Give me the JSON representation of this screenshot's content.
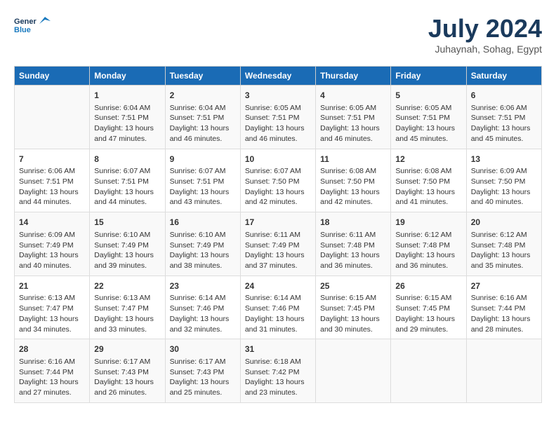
{
  "header": {
    "logo_line1": "General",
    "logo_line2": "Blue",
    "title": "July 2024",
    "subtitle": "Juhaynah, Sohag, Egypt"
  },
  "days_of_week": [
    "Sunday",
    "Monday",
    "Tuesday",
    "Wednesday",
    "Thursday",
    "Friday",
    "Saturday"
  ],
  "weeks": [
    [
      {
        "day": "",
        "content": ""
      },
      {
        "day": "1",
        "content": "Sunrise: 6:04 AM\nSunset: 7:51 PM\nDaylight: 13 hours\nand 47 minutes."
      },
      {
        "day": "2",
        "content": "Sunrise: 6:04 AM\nSunset: 7:51 PM\nDaylight: 13 hours\nand 46 minutes."
      },
      {
        "day": "3",
        "content": "Sunrise: 6:05 AM\nSunset: 7:51 PM\nDaylight: 13 hours\nand 46 minutes."
      },
      {
        "day": "4",
        "content": "Sunrise: 6:05 AM\nSunset: 7:51 PM\nDaylight: 13 hours\nand 46 minutes."
      },
      {
        "day": "5",
        "content": "Sunrise: 6:05 AM\nSunset: 7:51 PM\nDaylight: 13 hours\nand 45 minutes."
      },
      {
        "day": "6",
        "content": "Sunrise: 6:06 AM\nSunset: 7:51 PM\nDaylight: 13 hours\nand 45 minutes."
      }
    ],
    [
      {
        "day": "7",
        "content": "Sunrise: 6:06 AM\nSunset: 7:51 PM\nDaylight: 13 hours\nand 44 minutes."
      },
      {
        "day": "8",
        "content": "Sunrise: 6:07 AM\nSunset: 7:51 PM\nDaylight: 13 hours\nand 44 minutes."
      },
      {
        "day": "9",
        "content": "Sunrise: 6:07 AM\nSunset: 7:51 PM\nDaylight: 13 hours\nand 43 minutes."
      },
      {
        "day": "10",
        "content": "Sunrise: 6:07 AM\nSunset: 7:50 PM\nDaylight: 13 hours\nand 42 minutes."
      },
      {
        "day": "11",
        "content": "Sunrise: 6:08 AM\nSunset: 7:50 PM\nDaylight: 13 hours\nand 42 minutes."
      },
      {
        "day": "12",
        "content": "Sunrise: 6:08 AM\nSunset: 7:50 PM\nDaylight: 13 hours\nand 41 minutes."
      },
      {
        "day": "13",
        "content": "Sunrise: 6:09 AM\nSunset: 7:50 PM\nDaylight: 13 hours\nand 40 minutes."
      }
    ],
    [
      {
        "day": "14",
        "content": "Sunrise: 6:09 AM\nSunset: 7:49 PM\nDaylight: 13 hours\nand 40 minutes."
      },
      {
        "day": "15",
        "content": "Sunrise: 6:10 AM\nSunset: 7:49 PM\nDaylight: 13 hours\nand 39 minutes."
      },
      {
        "day": "16",
        "content": "Sunrise: 6:10 AM\nSunset: 7:49 PM\nDaylight: 13 hours\nand 38 minutes."
      },
      {
        "day": "17",
        "content": "Sunrise: 6:11 AM\nSunset: 7:49 PM\nDaylight: 13 hours\nand 37 minutes."
      },
      {
        "day": "18",
        "content": "Sunrise: 6:11 AM\nSunset: 7:48 PM\nDaylight: 13 hours\nand 36 minutes."
      },
      {
        "day": "19",
        "content": "Sunrise: 6:12 AM\nSunset: 7:48 PM\nDaylight: 13 hours\nand 36 minutes."
      },
      {
        "day": "20",
        "content": "Sunrise: 6:12 AM\nSunset: 7:48 PM\nDaylight: 13 hours\nand 35 minutes."
      }
    ],
    [
      {
        "day": "21",
        "content": "Sunrise: 6:13 AM\nSunset: 7:47 PM\nDaylight: 13 hours\nand 34 minutes."
      },
      {
        "day": "22",
        "content": "Sunrise: 6:13 AM\nSunset: 7:47 PM\nDaylight: 13 hours\nand 33 minutes."
      },
      {
        "day": "23",
        "content": "Sunrise: 6:14 AM\nSunset: 7:46 PM\nDaylight: 13 hours\nand 32 minutes."
      },
      {
        "day": "24",
        "content": "Sunrise: 6:14 AM\nSunset: 7:46 PM\nDaylight: 13 hours\nand 31 minutes."
      },
      {
        "day": "25",
        "content": "Sunrise: 6:15 AM\nSunset: 7:45 PM\nDaylight: 13 hours\nand 30 minutes."
      },
      {
        "day": "26",
        "content": "Sunrise: 6:15 AM\nSunset: 7:45 PM\nDaylight: 13 hours\nand 29 minutes."
      },
      {
        "day": "27",
        "content": "Sunrise: 6:16 AM\nSunset: 7:44 PM\nDaylight: 13 hours\nand 28 minutes."
      }
    ],
    [
      {
        "day": "28",
        "content": "Sunrise: 6:16 AM\nSunset: 7:44 PM\nDaylight: 13 hours\nand 27 minutes."
      },
      {
        "day": "29",
        "content": "Sunrise: 6:17 AM\nSunset: 7:43 PM\nDaylight: 13 hours\nand 26 minutes."
      },
      {
        "day": "30",
        "content": "Sunrise: 6:17 AM\nSunset: 7:43 PM\nDaylight: 13 hours\nand 25 minutes."
      },
      {
        "day": "31",
        "content": "Sunrise: 6:18 AM\nSunset: 7:42 PM\nDaylight: 13 hours\nand 23 minutes."
      },
      {
        "day": "",
        "content": ""
      },
      {
        "day": "",
        "content": ""
      },
      {
        "day": "",
        "content": ""
      }
    ]
  ]
}
